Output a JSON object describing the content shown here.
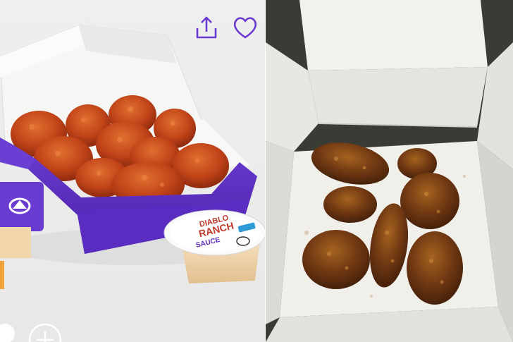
{
  "left_photo": {
    "sauce_cup_text": [
      "DIABLO",
      "RANCH",
      "SAUCE"
    ]
  },
  "icons": [
    "share-icon",
    "heart-icon",
    "plus-icon"
  ],
  "colors": {
    "taco_bell_purple": "#5b2bbf",
    "icon_purple": "#6a3bd1",
    "nugget_orange": "#c7461d",
    "box_white": "#f4f3f0"
  }
}
